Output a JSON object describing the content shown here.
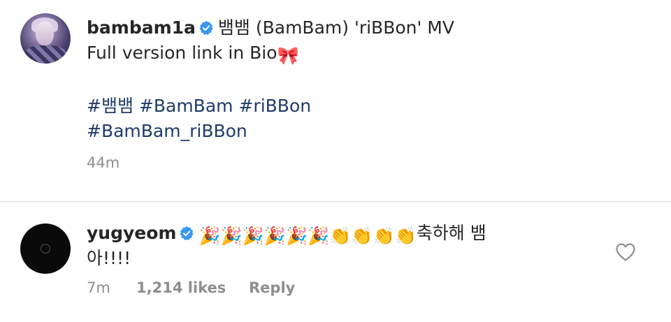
{
  "post": {
    "username": "bambam1a",
    "caption_line1": "뱀뱀 (BamBam) 'riBBon' MV",
    "caption_line2": "Full version link in Bio",
    "caption_line2_emoji": "🎀",
    "hashtags_line1": [
      "#뱀뱀",
      "#BamBam",
      "#riBBon"
    ],
    "hashtags_line2": [
      "#BamBam_riBBon"
    ],
    "time": "44m",
    "verified_icon": "verified-badge-icon"
  },
  "comment": {
    "username": "yugyeom",
    "emojis": "🎉🎉🎉🎉🎉🎉👏👏👏👏",
    "text_line1_suffix": "축하해 뱀",
    "text_line2": "아!!!!",
    "time": "7m",
    "likes": "1,214 likes",
    "reply_label": "Reply",
    "like_icon": "heart-outline-icon"
  },
  "colors": {
    "verified": "#3897f0",
    "hashtag": "#1f3b68",
    "meta": "#8e8e8e",
    "divider": "#dbdbdb"
  }
}
